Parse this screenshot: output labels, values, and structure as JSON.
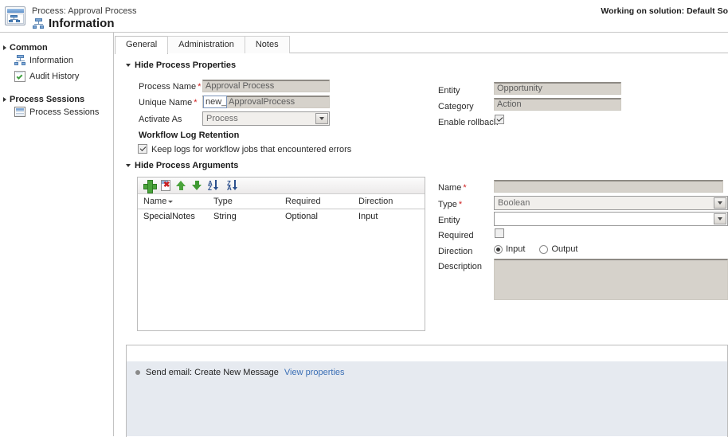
{
  "header": {
    "breadcrumb": "Process: Approval Process",
    "page_title": "Information",
    "solution_note": "Working on solution: Default So",
    "process_icon": "process-window-icon"
  },
  "sidebar": {
    "groups": [
      {
        "label": "Common",
        "items": [
          {
            "label": "Information",
            "icon": "process-node-icon"
          },
          {
            "label": "Audit History",
            "icon": "audit-checklist-icon"
          }
        ]
      },
      {
        "label": "Process Sessions",
        "items": [
          {
            "label": "Process Sessions",
            "icon": "sessions-grid-icon"
          }
        ]
      }
    ]
  },
  "tabs": [
    {
      "label": "General",
      "active": true
    },
    {
      "label": "Administration",
      "active": false
    },
    {
      "label": "Notes",
      "active": false
    }
  ],
  "process_properties": {
    "section_label": "Hide Process Properties",
    "fields": {
      "process_name_label": "Process Name",
      "process_name_value": "Approval Process",
      "unique_name_label": "Unique Name",
      "unique_name_prefix": "new_",
      "unique_name_value": "ApprovalProcess",
      "activate_as_label": "Activate As",
      "activate_as_value": "Process",
      "entity_label": "Entity",
      "entity_value": "Opportunity",
      "category_label": "Category",
      "category_value": "Action",
      "enable_rollback_label": "Enable rollback",
      "enable_rollback_checked": true
    }
  },
  "workflow_log_retention": {
    "heading": "Workflow Log Retention",
    "keep_logs_label": "Keep logs for workflow jobs that encountered errors",
    "keep_logs_checked": true
  },
  "process_arguments": {
    "section_label": "Hide Process Arguments",
    "toolbar": [
      {
        "name": "add-argument-icon",
        "title": "Add"
      },
      {
        "name": "delete-argument-icon",
        "title": "Delete"
      },
      {
        "name": "move-up-icon",
        "title": "Move Up"
      },
      {
        "name": "move-down-icon",
        "title": "Move Down"
      },
      {
        "name": "sort-ascending-icon",
        "title": "Sort Ascending"
      },
      {
        "name": "sort-descending-icon",
        "title": "Sort Descending"
      }
    ],
    "columns": [
      "Name",
      "Type",
      "Required",
      "Direction"
    ],
    "rows": [
      {
        "name": "SpecialNotes",
        "type": "String",
        "required": "Optional",
        "direction": "Input"
      }
    ],
    "detail": {
      "name_label": "Name",
      "name_value": "",
      "type_label": "Type",
      "type_value": "Boolean",
      "entity_label": "Entity",
      "entity_value": "",
      "required_label": "Required",
      "required_checked": false,
      "direction_label": "Direction",
      "direction_input": "Input",
      "direction_output": "Output",
      "direction_selected": "Input",
      "description_label": "Description",
      "description_value": ""
    }
  },
  "steps": {
    "items": [
      {
        "text": "Send email: Create New Message",
        "link": "View properties"
      }
    ]
  },
  "colors": {
    "readonly_field_bg": "#d6d2cb",
    "link": "#3b6fb5",
    "required_asterisk": "#cf2020",
    "steps_panel_bg": "#e6eaf0",
    "accent_green": "#4aa33a"
  }
}
